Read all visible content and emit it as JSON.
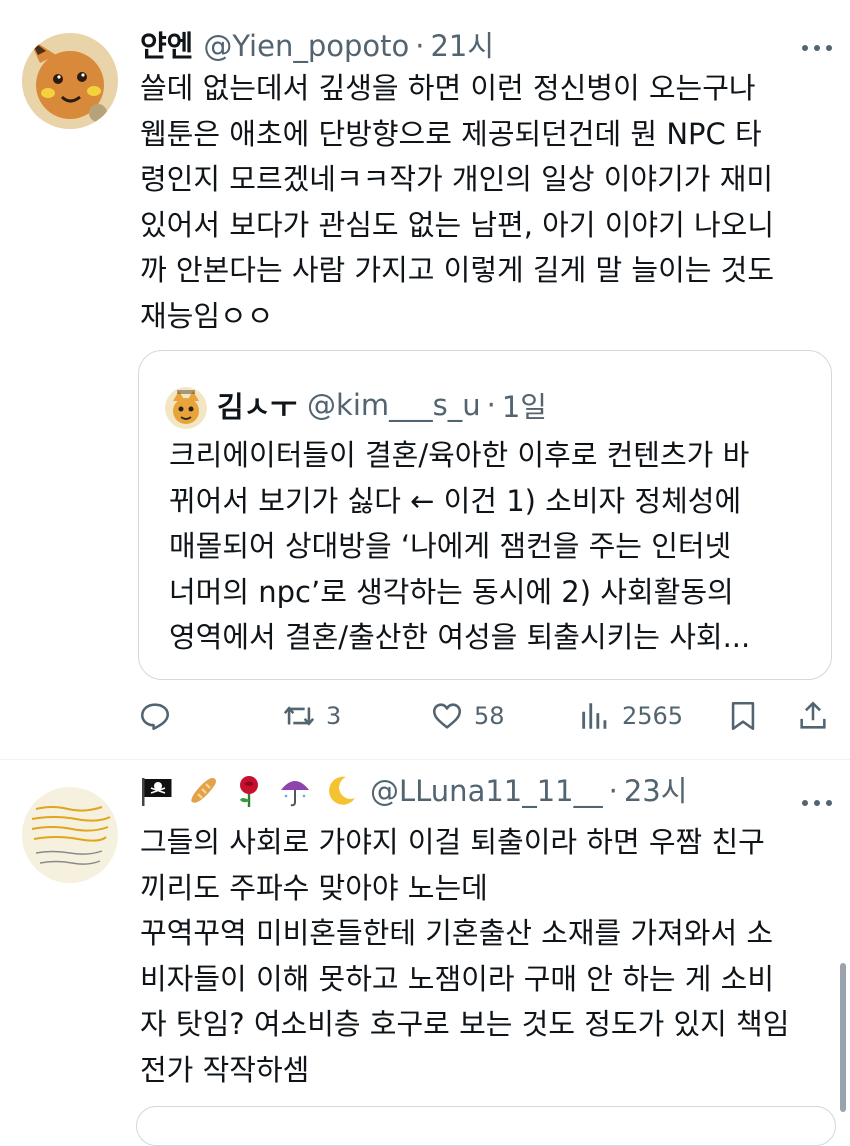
{
  "tweet1": {
    "display_name": "얀엔",
    "handle": "@Yien_popoto",
    "separator": "·",
    "time": "21시",
    "avatar_icon": "pokemon-raichu-avatar",
    "body_lines": [
      "쓸데 없는데서 깊생을 하면 이런 정신병이 오는구나",
      "웹툰은 애초에 단방향으로 제공되던건데 뭔 NPC 타",
      "령인지 모르겠네ㅋㅋ작가 개인의 일상 이야기가 재미",
      "있어서 보다가 관심도 없는 남편, 아기 이야기 나오니",
      "까 안본다는 사람 가지고 이렇게 길게 말 늘이는 것도",
      "재능임ㅇㅇ"
    ],
    "quote": {
      "display_name": "김ㅅㅜ",
      "handle": "@kim___s_u",
      "separator": "·",
      "time": "1일",
      "avatar_icon": "character-avatar",
      "body_lines": [
        "크리에이터들이 결혼/육아한 이후로 컨텐츠가 바",
        "뀌어서 보기가 싫다 ← 이건 1) 소비자 정체성에",
        "매몰되어 상대방을 ‘나에게 잼컨을 주는 인터넷",
        "너머의 npc’로 생각하는 동시에 2) 사회활동의",
        "영역에서 결혼/출산한 여성을 퇴출시키는 사회..."
      ]
    },
    "actions": {
      "reply_icon": "reply-icon",
      "retweet_icon": "retweet-icon",
      "retweet_count": "3",
      "like_icon": "heart-icon",
      "like_count": "58",
      "views_icon": "views-chart-icon",
      "views_count": "2565",
      "bookmark_icon": "bookmark-icon",
      "share_icon": "share-icon"
    }
  },
  "tweet2": {
    "name_emojis": [
      "pirate-flag",
      "bread",
      "rose",
      "umbrella",
      "crescent-moon"
    ],
    "handle": "@LLuna11_11__",
    "separator": "·",
    "time": "23시",
    "avatar_icon": "handwritten-note-avatar",
    "body_lines": [
      "그들의 사회로 가야지 이걸 퇴출이라 하면 우짬 친구",
      "끼리도 주파수 맞아야 노는데",
      "꾸역꾸역 미비혼들한테 기혼출산 소재를 가져와서 소",
      "비자들이 이해 못하고 노잼이라 구매 안 하는 게 소비",
      "자 탓임? 여소비층 호구로 보는 것도 정도가 있지 책임",
      "전가 작작하셈"
    ]
  }
}
